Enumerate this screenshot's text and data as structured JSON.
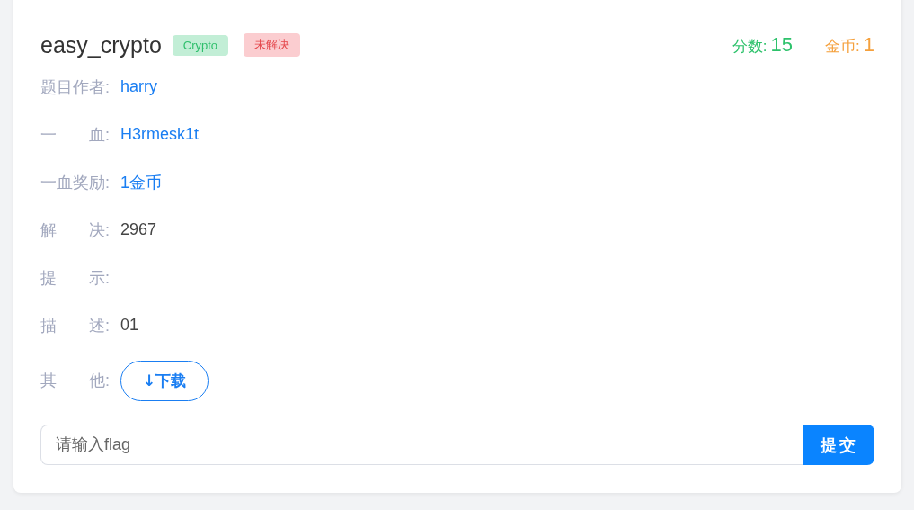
{
  "challenge": {
    "title": "easy_crypto",
    "tags": [
      {
        "label": "Crypto",
        "color": "#c2eed6"
      },
      {
        "label": "未解决",
        "color": "#fbcdd0"
      }
    ],
    "score": {
      "label": "分数:",
      "value": "15"
    },
    "coins": {
      "label": "金币:",
      "value": "1"
    }
  },
  "fields": [
    {
      "kind": "link",
      "label": "题目作者:",
      "value": "harry"
    },
    {
      "kind": "link",
      "label": "一　　血:",
      "value": "H3rmesk1t"
    },
    {
      "kind": "link",
      "label": "一血奖励:",
      "value": "1金币"
    },
    {
      "kind": "text",
      "label": "解　　决:",
      "value": "2967"
    },
    {
      "kind": "text",
      "label": "提　　示:"
    },
    {
      "kind": "text",
      "label": "描　　述:",
      "value": "01"
    },
    {
      "kind": "button",
      "label": "其　　他:",
      "value": "↓下载"
    }
  ],
  "flag_form": {
    "placeholder": "请输入flag",
    "submit": "提交"
  }
}
